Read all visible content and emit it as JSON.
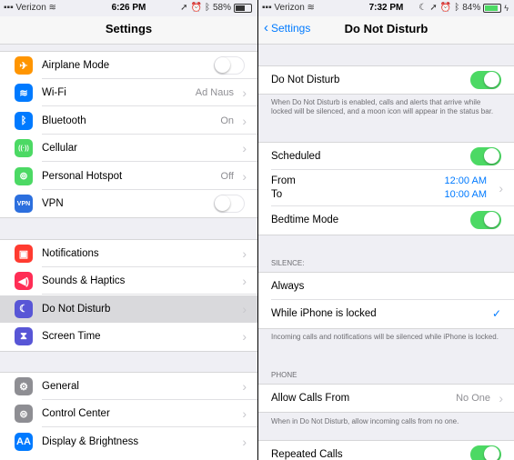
{
  "left": {
    "status": {
      "carrier": "Verizon",
      "time": "6:26 PM",
      "battery": "58%"
    },
    "title": "Settings",
    "group1": [
      {
        "label": "Airplane Mode",
        "icon": "airplane-icon",
        "color": "#ff9500",
        "glyph": "✈",
        "type": "toggle",
        "on": false
      },
      {
        "label": "Wi-Fi",
        "icon": "wifi-icon",
        "color": "#007aff",
        "glyph": "≋",
        "value": "Ad Naus",
        "type": "chevron"
      },
      {
        "label": "Bluetooth",
        "icon": "bluetooth-icon",
        "color": "#007aff",
        "glyph": "ᛒ",
        "value": "On",
        "type": "chevron"
      },
      {
        "label": "Cellular",
        "icon": "cellular-icon",
        "color": "#4cd964",
        "glyph": "((·))",
        "type": "chevron"
      },
      {
        "label": "Personal Hotspot",
        "icon": "hotspot-icon",
        "color": "#4cd964",
        "glyph": "⊚",
        "value": "Off",
        "type": "chevron"
      },
      {
        "label": "VPN",
        "icon": "vpn-icon",
        "color": "#2c6fde",
        "glyph": "VPN",
        "type": "toggle",
        "on": false
      }
    ],
    "group2": [
      {
        "label": "Notifications",
        "icon": "notifications-icon",
        "color": "#ff3b30",
        "glyph": "▣",
        "type": "chevron"
      },
      {
        "label": "Sounds & Haptics",
        "icon": "sounds-icon",
        "color": "#ff2d55",
        "glyph": "◀)",
        "type": "chevron"
      },
      {
        "label": "Do Not Disturb",
        "icon": "moon-icon",
        "color": "#5856d6",
        "glyph": "☾",
        "type": "chevron",
        "selected": true
      },
      {
        "label": "Screen Time",
        "icon": "hourglass-icon",
        "color": "#5856d6",
        "glyph": "⧗",
        "type": "chevron"
      }
    ],
    "group3": [
      {
        "label": "General",
        "icon": "gear-icon",
        "color": "#8e8e93",
        "glyph": "⚙",
        "type": "chevron"
      },
      {
        "label": "Control Center",
        "icon": "switches-icon",
        "color": "#8e8e93",
        "glyph": "⊜",
        "type": "chevron"
      },
      {
        "label": "Display & Brightness",
        "icon": "display-icon",
        "color": "#007aff",
        "glyph": "AA",
        "type": "chevron"
      }
    ]
  },
  "right": {
    "status": {
      "carrier": "Verizon",
      "time": "7:32 PM",
      "battery": "84%"
    },
    "back": "Settings",
    "title": "Do Not Disturb",
    "dnd_label": "Do Not Disturb",
    "dnd_note": "When Do Not Disturb is enabled, calls and alerts that arrive while locked will be silenced, and a moon icon will appear in the status bar.",
    "scheduled_label": "Scheduled",
    "from_label": "From",
    "to_label": "To",
    "from_value": "12:00 AM",
    "to_value": "10:00 AM",
    "bedtime_label": "Bedtime Mode",
    "silence_header": "SILENCE:",
    "always_label": "Always",
    "locked_label": "While iPhone is locked",
    "silence_note": "Incoming calls and notifications will be silenced while iPhone is locked.",
    "phone_header": "PHONE",
    "allow_label": "Allow Calls From",
    "allow_value": "No One",
    "allow_note": "When in Do Not Disturb, allow incoming calls from no one.",
    "repeated_label": "Repeated Calls"
  }
}
